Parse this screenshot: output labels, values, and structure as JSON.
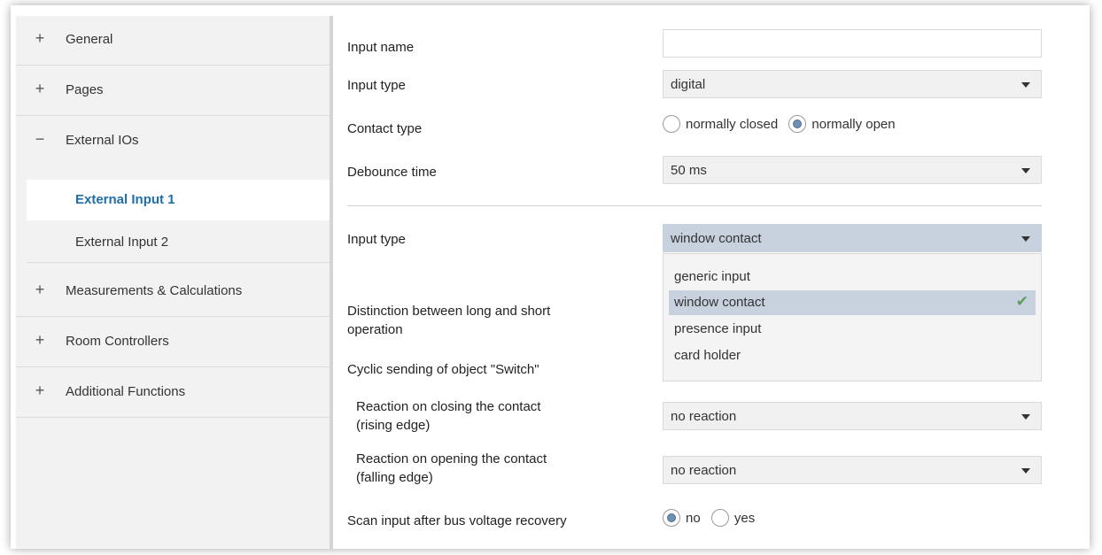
{
  "sidebar": {
    "items": [
      {
        "sign": "+",
        "label": "General"
      },
      {
        "sign": "+",
        "label": "Pages"
      },
      {
        "sign": "−",
        "label": "External IOs"
      },
      {
        "sign": "+",
        "label": "Measurements & Calculations"
      },
      {
        "sign": "+",
        "label": "Room Controllers"
      },
      {
        "sign": "+",
        "label": "Additional Functions"
      }
    ],
    "subitems": [
      {
        "label": "External Input 1",
        "active": true
      },
      {
        "label": "External Input 2",
        "active": false
      }
    ]
  },
  "form": {
    "input_name": {
      "label": "Input name",
      "value": ""
    },
    "input_type": {
      "label": "Input type",
      "value": "digital"
    },
    "contact_type": {
      "label": "Contact type",
      "options": [
        "normally closed",
        "normally open"
      ],
      "selected": "normally open"
    },
    "debounce_time": {
      "label": "Debounce time",
      "value": "50 ms"
    },
    "input_type2": {
      "label": "Input type",
      "value": "window contact",
      "options": [
        "generic input",
        "window contact",
        "presence input",
        "card holder"
      ],
      "selected": "window contact"
    },
    "distinction": {
      "label_line1": "Distinction between long and short",
      "label_line2": "operation"
    },
    "cyclic_sending": {
      "label": "Cyclic sending of object \"Switch\""
    },
    "reaction_closing": {
      "label_line1": "Reaction on closing the contact",
      "label_line2": "(rising edge)",
      "value": "no reaction"
    },
    "reaction_opening": {
      "label_line1": "Reaction on opening the contact",
      "label_line2": "(falling edge)",
      "value": "no reaction"
    },
    "scan_input": {
      "label": "Scan input after bus voltage recovery",
      "options": [
        "no",
        "yes"
      ],
      "selected": "no"
    }
  },
  "colors": {
    "accent": "#1f6ea8",
    "selected_bg": "#c7d2de",
    "check": "#5aa05a"
  }
}
